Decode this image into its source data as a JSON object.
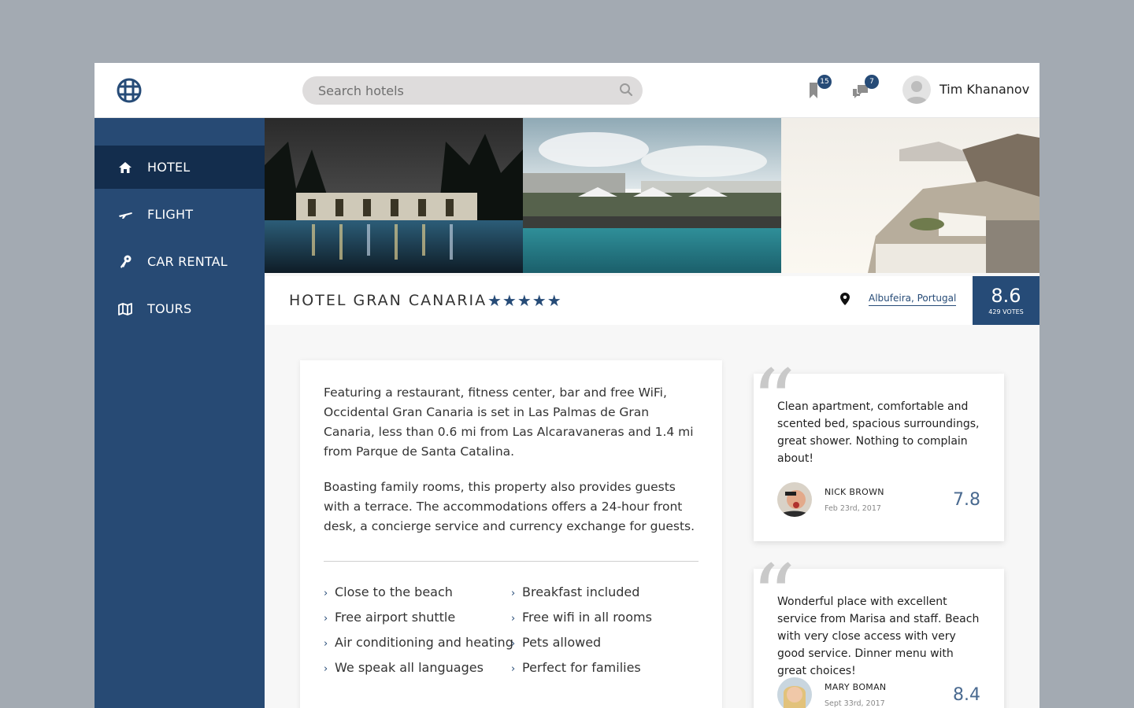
{
  "header": {
    "search_placeholder": "Search hotels",
    "bookmark_count": "15",
    "message_count": "7",
    "user_name": "Tim Khananov"
  },
  "sidebar": {
    "items": [
      {
        "label": "HOTEL",
        "icon": "home-icon",
        "active": true
      },
      {
        "label": "FLIGHT",
        "icon": "plane-icon"
      },
      {
        "label": "CAR RENTAL",
        "icon": "key-icon"
      },
      {
        "label": "TOURS",
        "icon": "map-icon"
      }
    ]
  },
  "hotel": {
    "name": "HOTEL GRAN CANARIA",
    "stars": "★★★★★",
    "star_count": 5,
    "location": "Albufeira, Portugal",
    "score": "8.6",
    "votes": "429 VOTES"
  },
  "description": {
    "paragraphs": [
      "Featuring a restaurant, fitness center, bar and free WiFi, Occidental Gran Canaria is set in Las Palmas de Gran Canaria, less than 0.6 mi from Las Alcaravaneras and 1.4 mi from Parque de Santa Catalina.",
      "Boasting family rooms, this property also provides guests with a terrace. The accommodations offers a 24-hour front desk, a concierge service and currency exchange for guests."
    ],
    "amenities": [
      "Close to the beach",
      "Free airport shuttle",
      "Air conditioning and heating",
      "We speak all languages",
      "Breakfast included",
      "Free wifi in all rooms",
      "Pets allowed",
      "Perfect for families"
    ]
  },
  "reviews": [
    {
      "text": "Clean apartment, comfortable and scented bed, spacious surroundings, great shower. Nothing to complain about!",
      "name": "NICK BROWN",
      "date": "Feb 23rd, 2017",
      "score": "7.8"
    },
    {
      "text": "Wonderful place with excellent service from Marisa and staff. Beach with very close access with very good service. Dinner menu with great choices!",
      "name": "MARY BOMAN",
      "date": "Sept 33rd, 2017",
      "score": "8.4"
    }
  ],
  "colors": {
    "brand": "#264b77",
    "sidebar": "#274a74",
    "sidebar_active": "#132d4d"
  }
}
